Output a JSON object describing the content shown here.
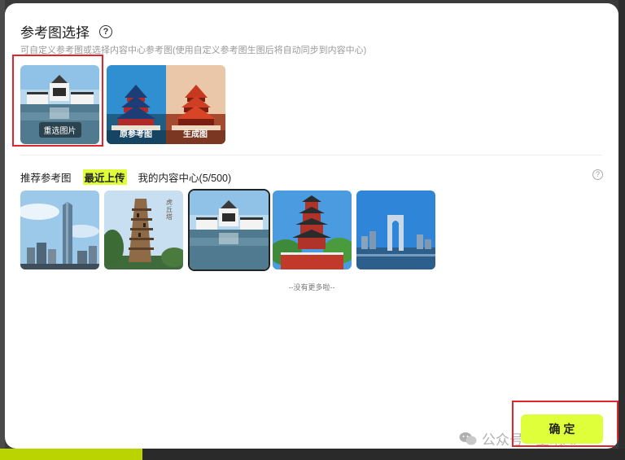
{
  "dialog": {
    "title": "参考图选择",
    "subtitle": "可自定义参考图或选择内容中心参考图(使用自定义参考图生图后将自动同步到内容中心)"
  },
  "reference": {
    "reselect_label": "重选图片",
    "original_label": "原参考图",
    "generated_label": "生成图"
  },
  "tabs": [
    {
      "label": "推荐参考图",
      "active": false
    },
    {
      "label": "最近上传",
      "active": true
    },
    {
      "label": "我的内容中心(5/500)",
      "active": false
    }
  ],
  "gallery": {
    "items": [
      {
        "name": "skyscraper"
      },
      {
        "name": "leaning-pagoda",
        "caption": "虎丘塔"
      },
      {
        "name": "museum",
        "selected": true
      },
      {
        "name": "red-pagoda"
      },
      {
        "name": "gate-building"
      }
    ],
    "empty_text": "--没有更多啦--"
  },
  "footer": {
    "confirm_label": "确 定",
    "watermark": "公众号 · 星晴AI"
  },
  "colors": {
    "accent": "#dfff3a",
    "highlight_box": "#e0262b"
  }
}
